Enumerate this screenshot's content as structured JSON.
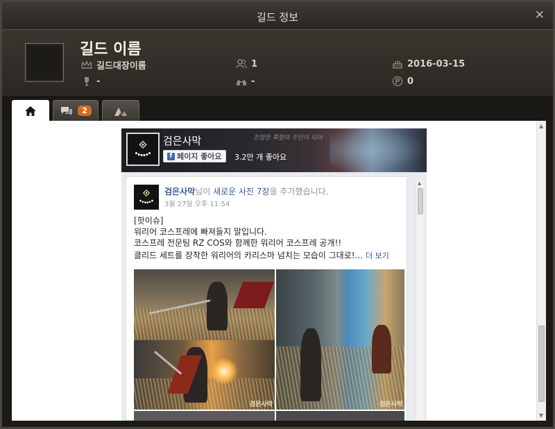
{
  "window": {
    "title": "길드 정보",
    "close_glyph": "✕"
  },
  "guild": {
    "name": "길드 이름",
    "leader": "길드대장이름",
    "members": "1",
    "founded": "2016-03-15",
    "rank": "-",
    "territory": "-",
    "points": "0"
  },
  "tabs": [
    {
      "name": "home",
      "icon": "home-icon"
    },
    {
      "name": "chat",
      "icon": "chat-icon",
      "badge": "2"
    },
    {
      "name": "camp",
      "icon": "camp-icon"
    }
  ],
  "facebook": {
    "page_name": "검은사막",
    "cover_tagline": "진정한 흑향의 주인이 되어",
    "like_button": "페이지 좋아요",
    "like_count": "3.2만 개 좋아요",
    "post": {
      "author": "검은사막",
      "action_pre": "님이 ",
      "action_photos": "새로운 사진 7장",
      "action_post": "을 추가했습니다.",
      "time": "3월 27일 오후 11:54",
      "lines": [
        "[핫이슈]",
        "워리어 코스프레에 빠져들지 말입니다.",
        "코스프레 전문팀 RZ COS와 함께한 워리어 코스프레 공개!!",
        "클리드 세트를 장착한 워리어의 카리스마 넘치는 모습이 그대로!..."
      ],
      "more": "더 보기",
      "watermark": "검은사막"
    }
  },
  "colors": {
    "window_bg": "#1c1a17",
    "accent_badge": "#d36b20",
    "fb_link": "#365899"
  }
}
